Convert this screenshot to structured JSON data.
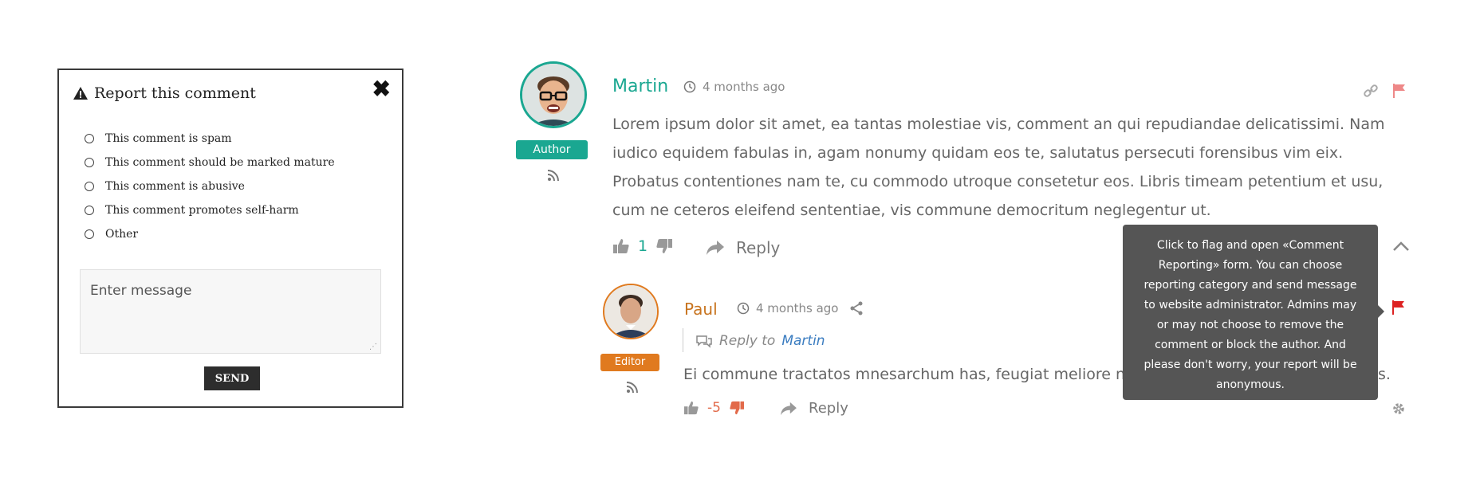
{
  "report_modal": {
    "title": "Report this comment",
    "close_glyph": "✖",
    "options": [
      "This comment is spam",
      "This comment should be marked mature",
      "This comment is abusive",
      "This comment promotes self-harm",
      "Other"
    ],
    "message_placeholder": "Enter message",
    "send_label": "SEND"
  },
  "comments": {
    "martin": {
      "name": "Martin",
      "time": "4 months ago",
      "badge": "Author",
      "text": "Lorem ipsum dolor sit amet, ea tantas molestiae vis, comment an qui repudiandae delicatissimi. Nam iudico equidem fabulas in, agam nonumy quidam eos te, salutatus persecuti forensibus vim eix. Probatus contentiones nam te, cu commodo utroque consetetur eos. Libris timeam petentium et usu, cum ne ceteros eleifend sententiae, vis commune democritum neglegentur ut.",
      "votes": "1",
      "reply_label": "Reply",
      "name_color": "#1aa791"
    },
    "paul": {
      "name": "Paul",
      "time": "4 months ago",
      "badge": "Editor",
      "reply_to_prefix": "Reply to",
      "reply_to_name": "Martin",
      "text": "Ei commune tractatos mnesarchum has, feugiat meliore no",
      "text_end": "s.",
      "votes": "-5",
      "reply_label": "Reply",
      "name_color": "#c8741f"
    }
  },
  "tooltip": {
    "lines": [
      "Click to flag and open «Comment",
      "Reporting» form. You can choose",
      "reporting category and send message",
      "to website administrator. Admins may",
      "or may not choose to remove the",
      "comment or block the author. And",
      "please don't worry, your report will be",
      "anonymous."
    ]
  },
  "colors": {
    "author_green": "#1aa791",
    "editor_orange": "#e07a1f",
    "flag_red": "#e23c3c",
    "negative_vote": "#e26a4a",
    "link_blue": "#3a7cc0"
  },
  "icons": [
    "warning-icon",
    "close-icon",
    "rss-icon",
    "clock-icon",
    "link-icon",
    "flag-icon",
    "thumbs-up-icon",
    "thumbs-down-icon",
    "reply-icon",
    "share-icon",
    "comment-icon",
    "chevron-up-icon",
    "gear-icon"
  ]
}
